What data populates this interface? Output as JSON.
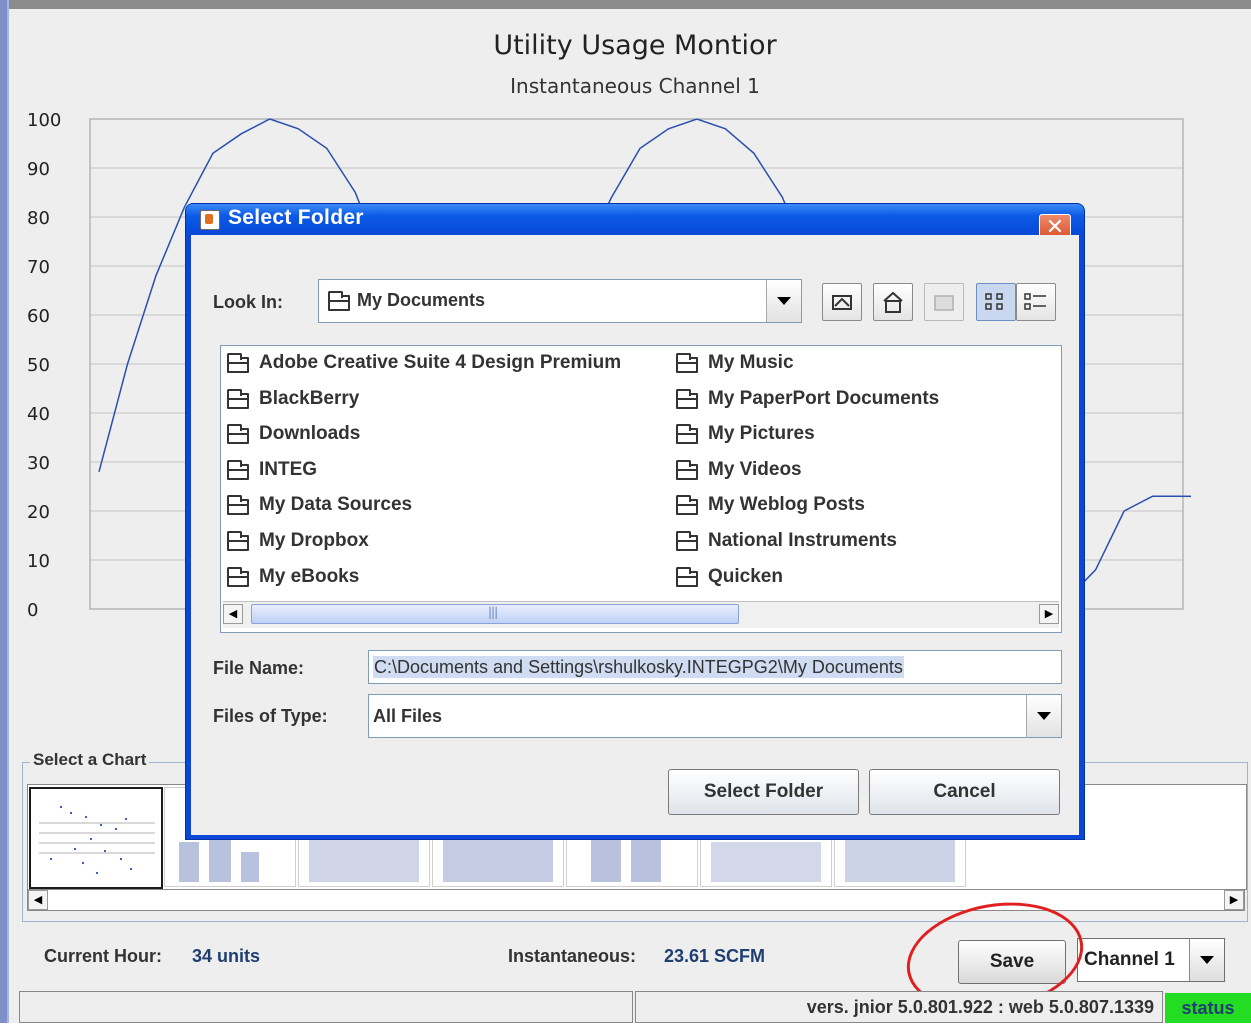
{
  "chart": {
    "title": "Utility Usage Montior",
    "subtitle": "Instantaneous Channel 1"
  },
  "chart_data": {
    "type": "line",
    "title": "Utility Usage Montior",
    "subtitle": "Instantaneous Channel 1",
    "xlabel": "",
    "ylabel": "",
    "ylim": [
      0,
      100
    ],
    "y_ticks": [
      "100",
      "90",
      "80",
      "70",
      "60",
      "50",
      "40",
      "30",
      "20",
      "10",
      "0"
    ],
    "grid": true,
    "color": "#2a4fb0",
    "series": [
      {
        "values": [
          28,
          50,
          68,
          82,
          93,
          97,
          100,
          98,
          94,
          85,
          70,
          58,
          48,
          40,
          38,
          48,
          60,
          72,
          84,
          94,
          98,
          100,
          98,
          93,
          84,
          70,
          55,
          40,
          25,
          12,
          3,
          0,
          0,
          0,
          2,
          8,
          20,
          23,
          23
        ]
      }
    ]
  },
  "select_chart": {
    "label": "Select a Chart"
  },
  "bottom": {
    "current_hour_label": "Current Hour:",
    "current_hour_value": "34 units",
    "instantaneous_label": "Instantaneous:",
    "instantaneous_value": "23.61 SCFM",
    "save_label": "Save",
    "channel_value": "Channel 1",
    "version_text": "vers. jnior 5.0.801.922 : web 5.0.807.1339",
    "status_label": "status"
  },
  "dialog": {
    "title": "Select Folder",
    "close_glyph": "✕",
    "look_in_label": "Look In:",
    "look_in_value": "My Documents",
    "files_left": [
      "Adobe Creative Suite 4 Design Premium",
      "BlackBerry",
      "Downloads",
      "INTEG",
      "My Data Sources",
      "My Dropbox",
      "My eBooks"
    ],
    "files_right": [
      "My Music",
      "My PaperPort Documents",
      "My Pictures",
      "My Videos",
      "My Weblog Posts",
      "National Instruments",
      "Quicken"
    ],
    "file_name_label": "File Name:",
    "file_name_value": "C:\\Documents and Settings\\rshulkosky.INTEGPG2\\My Documents",
    "files_of_type_label": "Files of Type:",
    "files_of_type_value": "All Files",
    "select_button": "Select Folder",
    "cancel_button": "Cancel",
    "scroll_left": "◀",
    "scroll_right": "▶"
  },
  "icons": {
    "toolbar": [
      "up-one-level-icon",
      "home-icon",
      "new-folder-icon",
      "list-view-icon",
      "details-view-icon"
    ]
  }
}
